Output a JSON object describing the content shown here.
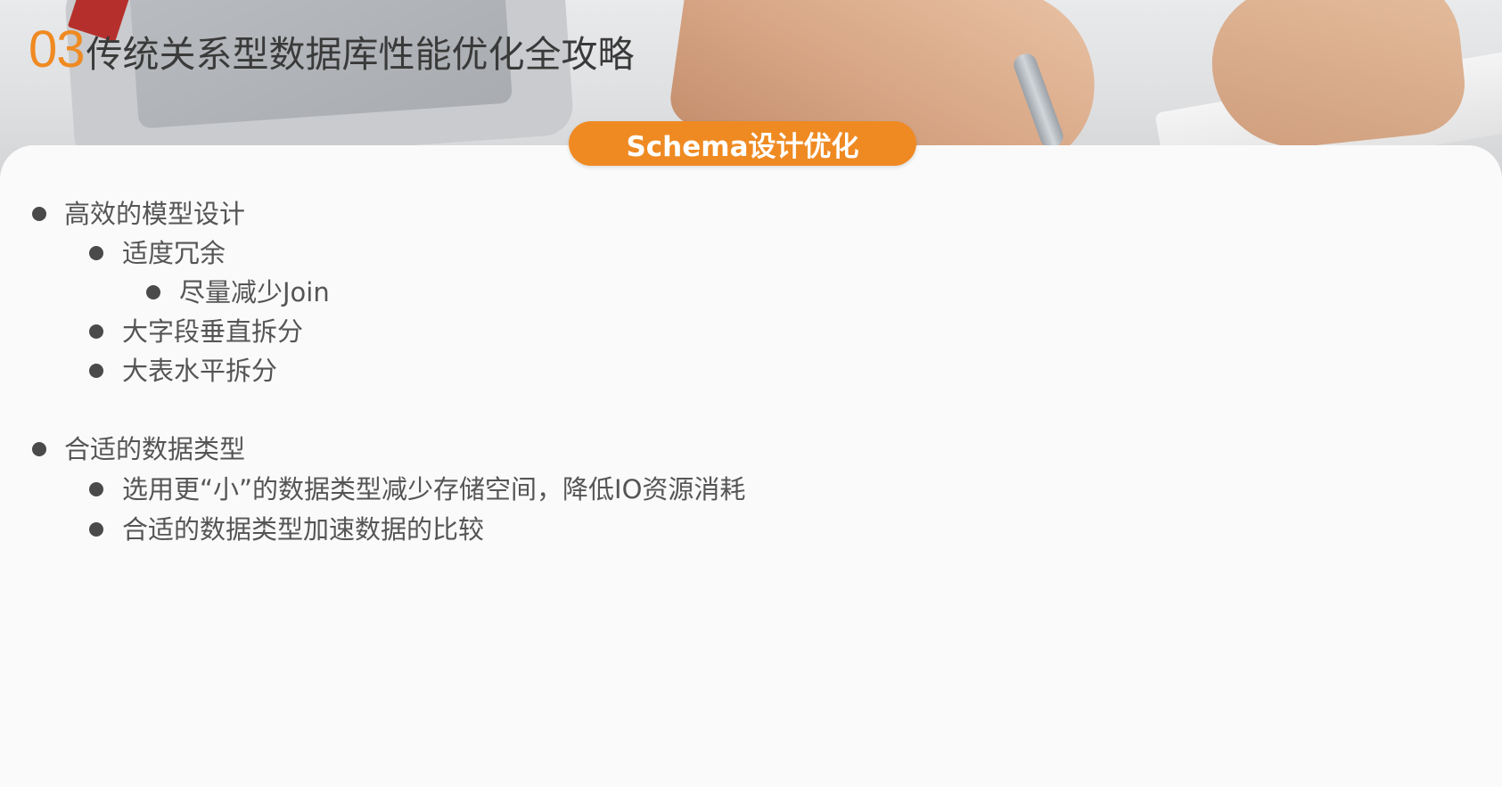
{
  "slide": {
    "title_number": "03",
    "title_text": "传统关系型数据库性能优化全攻略",
    "section_badge": "Schema设计优化"
  },
  "colors": {
    "accent": "#ef8a22",
    "title_text": "#3a3a3a",
    "body_text": "#555555",
    "bullet_dot": "#4a4a4a",
    "card_background": "#fafafa"
  },
  "outline": [
    {
      "label": "高效的模型设计",
      "children": [
        {
          "label": "适度冗余",
          "children": [
            {
              "label": "尽量减少Join"
            }
          ]
        },
        {
          "label": "大字段垂直拆分"
        },
        {
          "label": "大表水平拆分"
        }
      ]
    },
    {
      "label": "合适的数据类型",
      "children": [
        {
          "label": "选用更“小”的数据类型减少存储空间，降低IO资源消耗"
        },
        {
          "label": "合适的数据类型加速数据的比较"
        }
      ]
    }
  ]
}
